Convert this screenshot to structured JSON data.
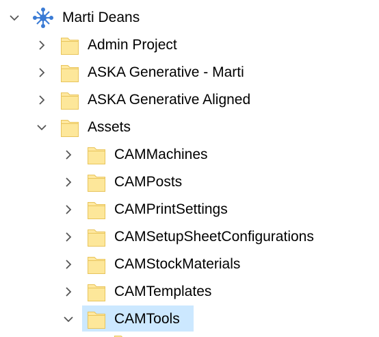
{
  "tree": {
    "root": {
      "label": "Marti Deans",
      "icon": "hub-icon",
      "expanded": true
    },
    "projects": [
      {
        "label": "Admin Project",
        "expanded": false
      },
      {
        "label": "ASKA Generative - Marti",
        "expanded": false
      },
      {
        "label": "ASKA Generative Aligned",
        "expanded": false
      },
      {
        "label": "Assets",
        "expanded": true
      }
    ],
    "asset_folders": [
      {
        "label": "CAMMachines",
        "expanded": false
      },
      {
        "label": "CAMPosts",
        "expanded": false
      },
      {
        "label": "CAMPrintSettings",
        "expanded": false
      },
      {
        "label": "CAMSetupSheetConfigurations",
        "expanded": false
      },
      {
        "label": "CAMStockMaterials",
        "expanded": false
      },
      {
        "label": "CAMTemplates",
        "expanded": false
      },
      {
        "label": "CAMTools",
        "expanded": true,
        "selected": true
      }
    ]
  },
  "colors": {
    "selection": "#cce8ff",
    "folder_fill": "#ffe8a0",
    "folder_stroke": "#e8c45a",
    "hub_blue": "#3a7bd5",
    "chevron": "#555555"
  }
}
